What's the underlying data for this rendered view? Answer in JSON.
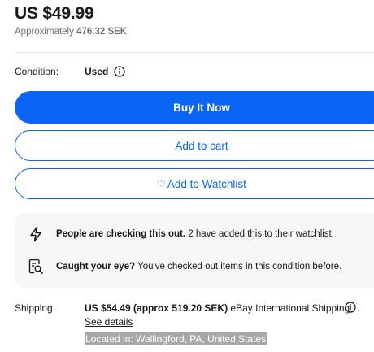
{
  "price": {
    "main": "US $49.99",
    "approx_prefix": "Approximately",
    "approx_value": "476.32 SEK"
  },
  "condition": {
    "label": "Condition:",
    "value": "Used"
  },
  "buttons": {
    "buy_now": "Buy It Now",
    "add_to_cart": "Add to cart",
    "add_to_watchlist": "Add to Watchlist"
  },
  "notices": [
    {
      "icon": "lightning-icon",
      "bold": "People are checking this out.",
      "text": " 2 have added this to their watchlist."
    },
    {
      "icon": "magnifier-document-icon",
      "bold": "Caught your eye?",
      "text": " You've checked out items in this condition before."
    }
  ],
  "shipping": {
    "label": "Shipping:",
    "cost": "US $54.49 (approx 519.20 SEK)",
    "service": " eBay International Shipping",
    "see_details": "See details",
    "location": "Located in: Wallingford, PA, United States"
  },
  "colors": {
    "accent": "#0a64f5",
    "text": "#191919",
    "muted": "#707070",
    "panel_bg": "#f7f7f7",
    "location_highlight": "#a8a8a8"
  }
}
